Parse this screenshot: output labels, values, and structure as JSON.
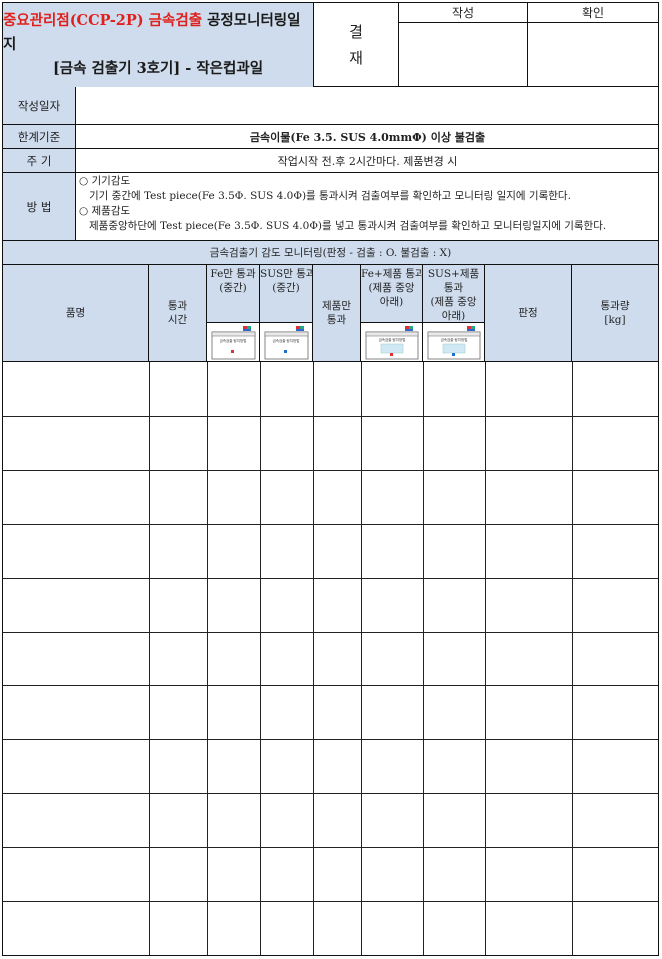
{
  "header": {
    "title_red": "중요관리점(CCP-2P) 금속검출",
    "title_black": " 공정모니터링일지",
    "subtitle": "[금속 검출기 3호기] - 작은컵과일",
    "approval_top": "결",
    "approval_bottom": "재",
    "author_label": "작성",
    "confirm_label": "확인"
  },
  "info": {
    "date_label": "작성일자",
    "date_value": "",
    "limit_label": "한계기준",
    "limit_value": "금속이물(Fe 3.5. SUS 4.0mmΦ) 이상 불검출",
    "cycle_label": "주    기",
    "cycle_value": "작업시작 전.후 2시간마다. 제품변경 시",
    "method_label": "방     법",
    "method_lines": [
      "○ 기기감도",
      "   기기 중간에 Test piece(Fe 3.5Φ. SUS 4.0Φ)를 통과시켜 검출여부를 확인하고 모니터링 일지에 기록한다.",
      "○ 제품감도",
      "   제품중앙하단에 Test piece(Fe 3.5Φ. SUS 4.0Φ)를 넣고 통과시켜 검출여부를 확인하고 모니터링일지에 기록한다."
    ]
  },
  "section_title": "금속검출기 감도 모니터링(판정 - 검출 : O. 불검출 : X)",
  "columns": {
    "product": "품명",
    "pass_time": "통과\n시간",
    "fe_only": "Fe만 통과\n(중간)",
    "sus_only": "SUS만 통과\n(중간)",
    "product_only": "제품만\n통과",
    "fe_product": "Fe+제품 통과\n(제품 중앙\n아래)",
    "sus_product": "SUS+제품\n통과\n(제품 중앙\n아래)",
    "judgement": "판정",
    "pass_amount": "통과량\n[kg]",
    "thumb_caption": "금속검출 탐지방법"
  },
  "rows": [
    [
      "",
      "",
      "",
      "",
      "",
      "",
      "",
      "",
      ""
    ],
    [
      "",
      "",
      "",
      "",
      "",
      "",
      "",
      "",
      ""
    ],
    [
      "",
      "",
      "",
      "",
      "",
      "",
      "",
      "",
      ""
    ],
    [
      "",
      "",
      "",
      "",
      "",
      "",
      "",
      "",
      ""
    ],
    [
      "",
      "",
      "",
      "",
      "",
      "",
      "",
      "",
      ""
    ],
    [
      "",
      "",
      "",
      "",
      "",
      "",
      "",
      "",
      ""
    ],
    [
      "",
      "",
      "",
      "",
      "",
      "",
      "",
      "",
      ""
    ],
    [
      "",
      "",
      "",
      "",
      "",
      "",
      "",
      "",
      ""
    ],
    [
      "",
      "",
      "",
      "",
      "",
      "",
      "",
      "",
      ""
    ],
    [
      "",
      "",
      "",
      "",
      "",
      "",
      "",
      "",
      ""
    ],
    [
      "",
      "",
      "",
      "",
      "",
      "",
      "",
      "",
      ""
    ]
  ],
  "colors": {
    "header_bg": "#cfdced",
    "title_red": "#e0201c",
    "border": "#111111"
  }
}
